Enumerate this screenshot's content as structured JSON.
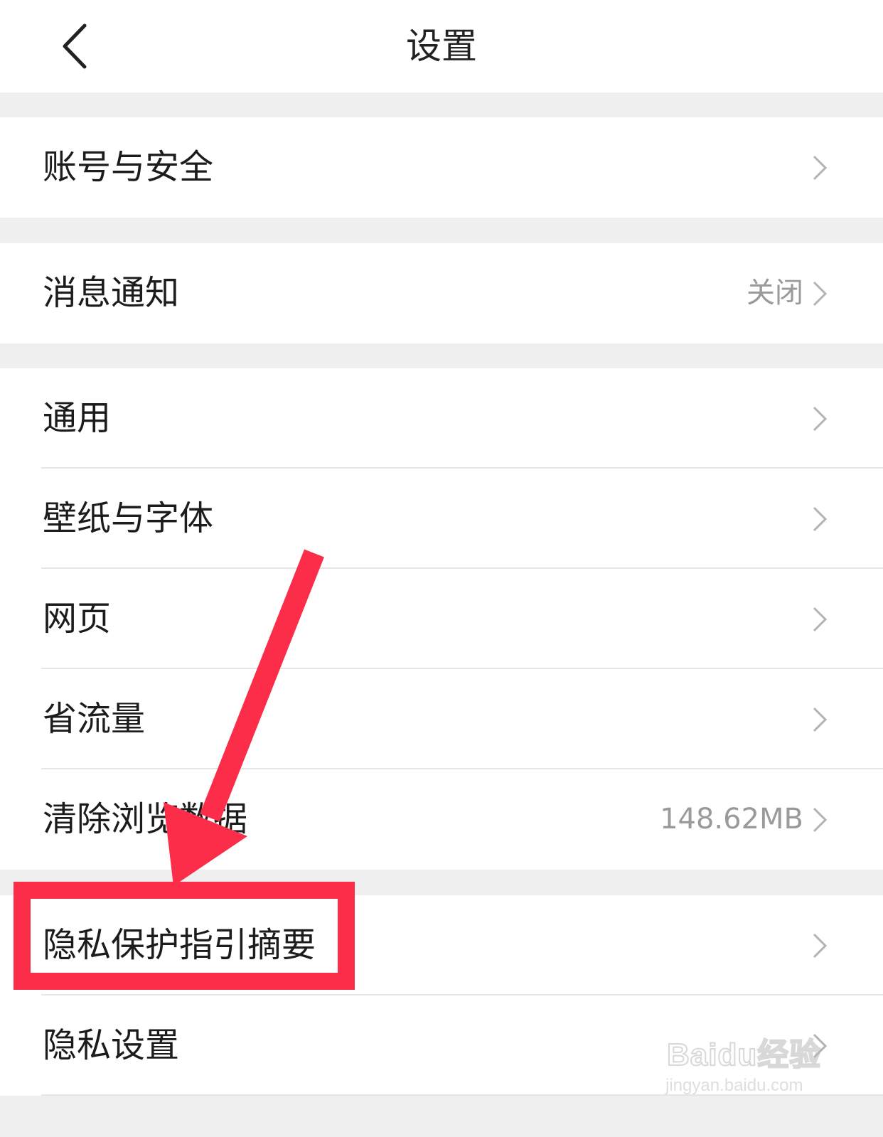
{
  "navbar": {
    "title": "设置"
  },
  "groups": [
    {
      "items": [
        {
          "label": "账号与安全",
          "value": ""
        }
      ]
    },
    {
      "items": [
        {
          "label": "消息通知",
          "value": "关闭"
        }
      ]
    },
    {
      "items": [
        {
          "label": "通用",
          "value": ""
        },
        {
          "label": "壁纸与字体",
          "value": ""
        },
        {
          "label": "网页",
          "value": ""
        },
        {
          "label": "省流量",
          "value": ""
        },
        {
          "label": "清除浏览数据",
          "value": "148.62MB"
        }
      ]
    },
    {
      "items": [
        {
          "label": "隐私保护指引摘要",
          "value": ""
        },
        {
          "label": "隐私设置",
          "value": ""
        }
      ]
    }
  ],
  "annotation": {
    "color": "#fb2d48",
    "highlighted_item": "隐私保护指引摘要"
  },
  "watermark": {
    "brand": "Baidu经验",
    "url": "jingyan.baidu.com"
  },
  "icons": {
    "back": "chevron-left-icon",
    "row_arrow": "chevron-right-icon"
  }
}
